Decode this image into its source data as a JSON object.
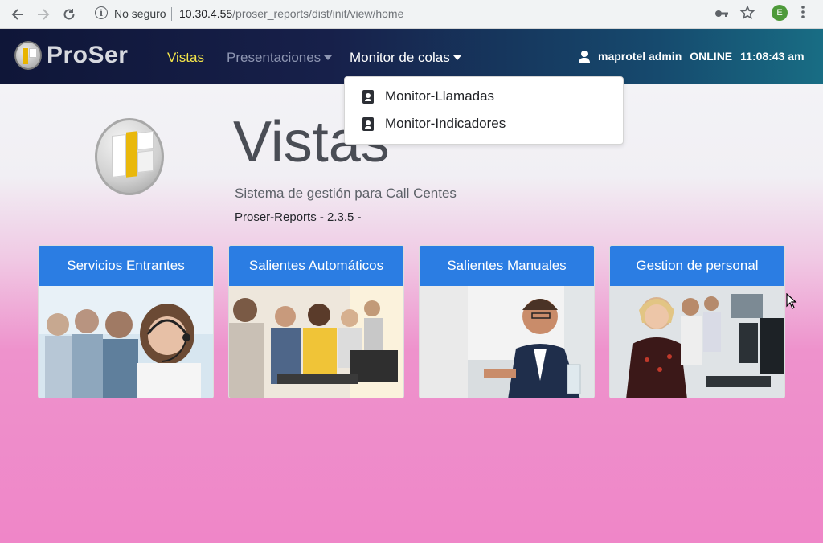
{
  "browser": {
    "security_label": "No seguro",
    "url_host": "10.30.4.55",
    "url_path": "/proser_reports/dist/init/view/home",
    "profile_initial": "E",
    "icons": [
      "back-arrow-icon",
      "forward-arrow-icon",
      "reload-icon",
      "info-icon",
      "key-icon",
      "star-icon",
      "kebab-menu-icon"
    ]
  },
  "navbar": {
    "logo_text": "ProSer",
    "items": [
      {
        "label": "Vistas",
        "active": true
      },
      {
        "label": "Presentaciones",
        "has_dropdown": true
      },
      {
        "label": "Monitor de colas",
        "has_dropdown": true,
        "open": true
      }
    ],
    "user_name": "maprotel admin",
    "status": "ONLINE",
    "time": "11:08:43 am",
    "colors": {
      "active": "#f5e64a",
      "muted": "#8e96b2",
      "bg_start": "#0f1638",
      "bg_end": "#186d84"
    }
  },
  "dropdown": {
    "items": [
      {
        "label": "Monitor-Llamadas",
        "icon": "contact-badge-icon"
      },
      {
        "label": "Monitor-Indicadores",
        "icon": "contact-badge-icon"
      }
    ]
  },
  "hero": {
    "title": "Vistas",
    "subtitle": "Sistema de gestión para Call Centes",
    "version": "Proser-Reports - 2.3.5 -"
  },
  "cards": [
    {
      "title": "Servicios Entrantes"
    },
    {
      "title": "Salientes Automáticos"
    },
    {
      "title": "Salientes Manuales"
    },
    {
      "title": "Gestion de personal"
    }
  ],
  "colors": {
    "card_header": "#2b7de3",
    "page_pink": "#ef86c8"
  }
}
